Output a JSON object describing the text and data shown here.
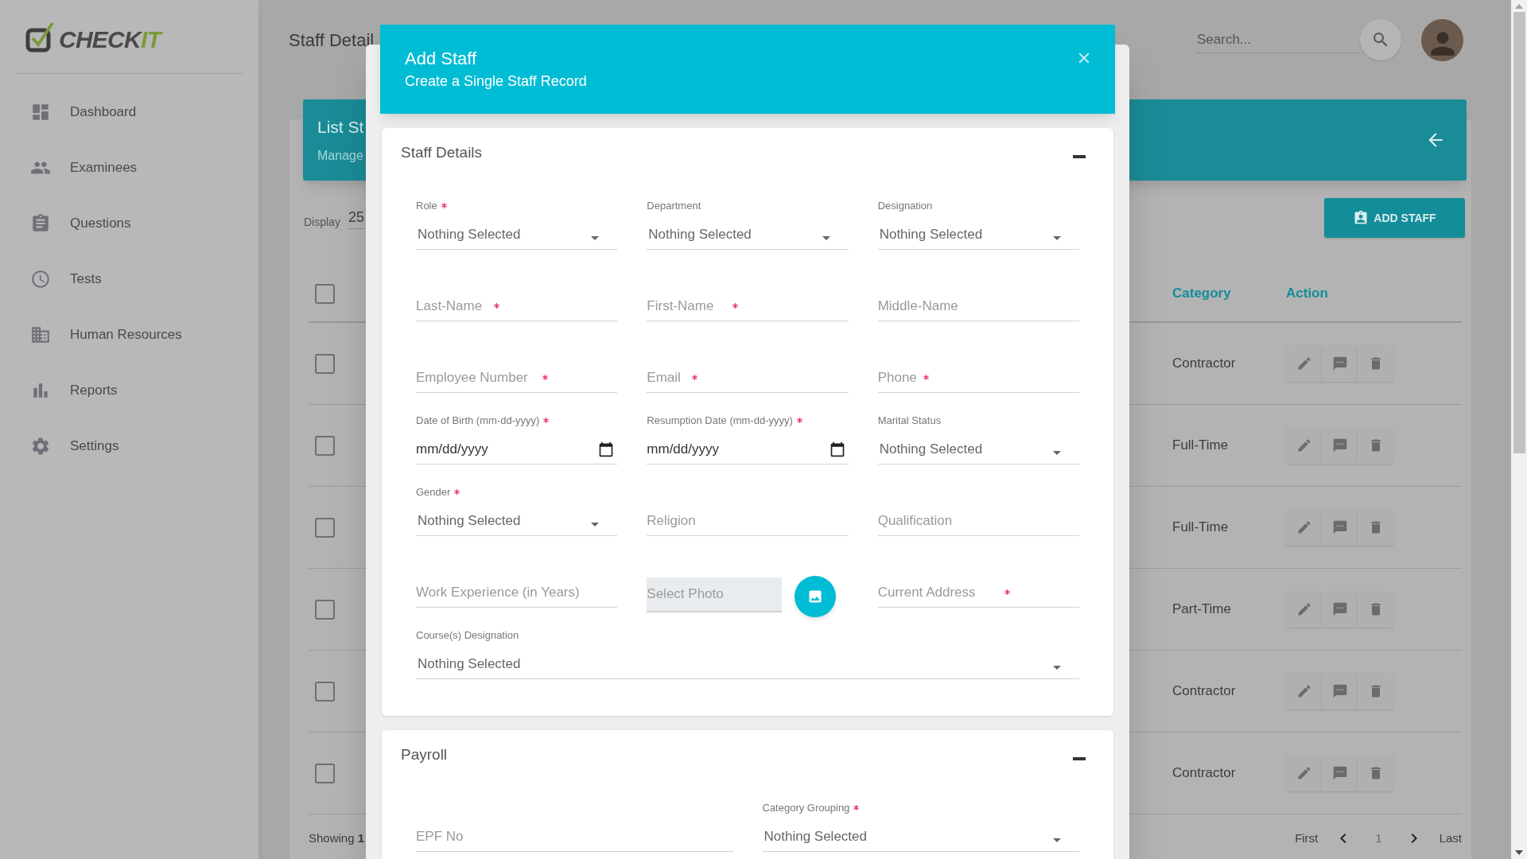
{
  "sidebar": {
    "logo": [
      {
        "text": "CHECK",
        "color": "#4a4a4a"
      },
      {
        "text": "IT",
        "color": "#7a9a3a"
      }
    ],
    "items": [
      {
        "label": "Dashboard"
      },
      {
        "label": "Examinees"
      },
      {
        "label": "Questions"
      },
      {
        "label": "Tests"
      },
      {
        "label": "Human Resources"
      },
      {
        "label": "Reports"
      },
      {
        "label": "Settings"
      }
    ]
  },
  "header": {
    "title": "Staff Detail",
    "search": {
      "placeholder": "Search..."
    }
  },
  "list_card": {
    "title": "List St",
    "subtitle": "Manage",
    "display_label": "Display",
    "display_value": "25",
    "add_button": "ADD STAFF"
  },
  "table": {
    "select_all": {
      "checked": false
    },
    "columns": [
      "Category",
      "Action"
    ],
    "rows": [
      {
        "checked": false,
        "category": "Contractor"
      },
      {
        "checked": false,
        "category": "Full-Time"
      },
      {
        "checked": false,
        "category": "Full-Time"
      },
      {
        "checked": false,
        "category": "Part-Time"
      },
      {
        "checked": false,
        "category": "Contractor"
      },
      {
        "checked": false,
        "category": "Contractor"
      }
    ]
  },
  "pagination": {
    "showing": "Showing **1**",
    "first": "First",
    "page": "1",
    "last": "Last"
  },
  "modal": {
    "title": "Add Staff",
    "subtitle": "Create a Single Staff Record",
    "sections": [
      {
        "title": "Staff Details",
        "expanded": true,
        "fields": [
          {
            "kind": "select",
            "label": "Role",
            "required": true,
            "value": "Nothing Selected"
          },
          {
            "kind": "select",
            "label": "Department",
            "required": false,
            "value": "Nothing Selected"
          },
          {
            "kind": "select",
            "label": "Designation",
            "required": false,
            "value": "Nothing Selected"
          },
          {
            "kind": "text",
            "placeholder": "Last-Name",
            "required": true
          },
          {
            "kind": "text",
            "placeholder": "First-Name",
            "required": true
          },
          {
            "kind": "text",
            "placeholder": "Middle-Name",
            "required": false
          },
          {
            "kind": "text",
            "placeholder": "Employee Number",
            "required": true
          },
          {
            "kind": "text",
            "placeholder": "Email",
            "required": true
          },
          {
            "kind": "text",
            "placeholder": "Phone",
            "required": true
          },
          {
            "kind": "date",
            "label": "Date of Birth (mm-dd-yyyy)",
            "required": true,
            "value": "mm/dd/yyyy"
          },
          {
            "kind": "date",
            "label": "Resumption Date (mm-dd-yyyy)",
            "required": true,
            "value": "mm/dd/yyyy"
          },
          {
            "kind": "select",
            "label": "Marital Status",
            "required": false,
            "value": "Nothing Selected"
          },
          {
            "kind": "select",
            "label": "Gender",
            "required": true,
            "value": "Nothing Selected"
          },
          {
            "kind": "text",
            "placeholder": "Religion",
            "required": false
          },
          {
            "kind": "text",
            "placeholder": "Qualification",
            "required": false
          },
          {
            "kind": "text",
            "placeholder": "Work Experience (in Years)",
            "required": false
          },
          {
            "kind": "photo",
            "placeholder": "Select Photo"
          },
          {
            "kind": "text",
            "placeholder": "Current Address",
            "required": true
          },
          {
            "kind": "select",
            "label": "Course(s) Designation",
            "required": false,
            "value": "Nothing Selected",
            "wide": true
          }
        ]
      },
      {
        "title": "Payroll",
        "expanded": true,
        "fields": [
          {
            "kind": "text",
            "placeholder": "EPF No",
            "required": false
          },
          {
            "kind": "select",
            "label": "Category Grouping",
            "required": true,
            "value": "Nothing Selected"
          }
        ]
      }
    ]
  }
}
